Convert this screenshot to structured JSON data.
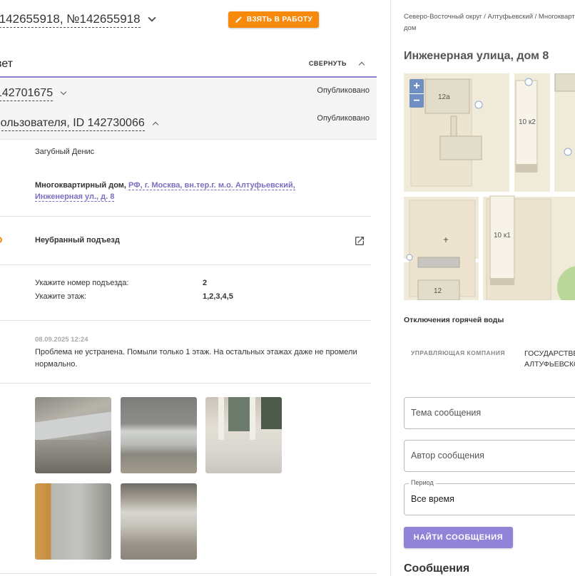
{
  "header": {
    "ticket_title": ".142655918, №142655918",
    "take_button": "ВЗЯТЬ В РАБОТУ"
  },
  "answer": {
    "title": "вет",
    "collapse_label": "СВЕРНУТЬ"
  },
  "items": [
    {
      "id_text": "142701675",
      "status": "Опубликовано"
    },
    {
      "id_text": "пользователя, ID 142730066",
      "status": "Опубликовано"
    }
  ],
  "details": {
    "author": "Загубный Денис",
    "object_type": "Многоквартирный дом,",
    "address_line1": "РФ, г. Москва, вн.тер.г. м.о. Алтуфьевский,",
    "address_line2": "Инженерная ул., д. 8",
    "problem": "Неубранный подъезд",
    "entrance_label": "Укажите номер подъезда:",
    "entrance_value": "2",
    "floor_label": "Укажите этаж:",
    "floor_value": "1,2,3,4,5",
    "comment_date": "08.09.2025 12:24",
    "comment_text_1": "Проблема не устранена. Помыли только 1 этаж. На остальных этажах даже не промели",
    "comment_text_2": "нормально."
  },
  "right": {
    "breadcrumb_line1": "Северо-Восточный округ / Алтуфьевский / Многоквартирный",
    "breadcrumb_line2": "дом",
    "address_title": "Инженерная улица, дом 8",
    "map_labels": [
      "12а",
      "10 к2",
      "10 к1",
      "12"
    ],
    "zoom_in": "+",
    "zoom_out": "−",
    "hot_water": "Отключения горячей воды",
    "uk_label": "УПРАВЛЯЮЩАЯ КОМПАНИЯ",
    "uk_value_1": "ГОСУДАРСТВЕННОЕ",
    "uk_value_2": "АЛТУФЬЕВСКОГО",
    "subject_placeholder": "Тема сообщения",
    "author_placeholder": "Автор сообщения",
    "period_legend": "Период",
    "period_value": "Все время",
    "find_button": "НАЙТИ СООБЩЕНИЯ",
    "messages_title": "Сообщения"
  },
  "colors": {
    "accent": "#8b7cd4",
    "orange": "#f7890c",
    "link": "#7a6fc2"
  }
}
